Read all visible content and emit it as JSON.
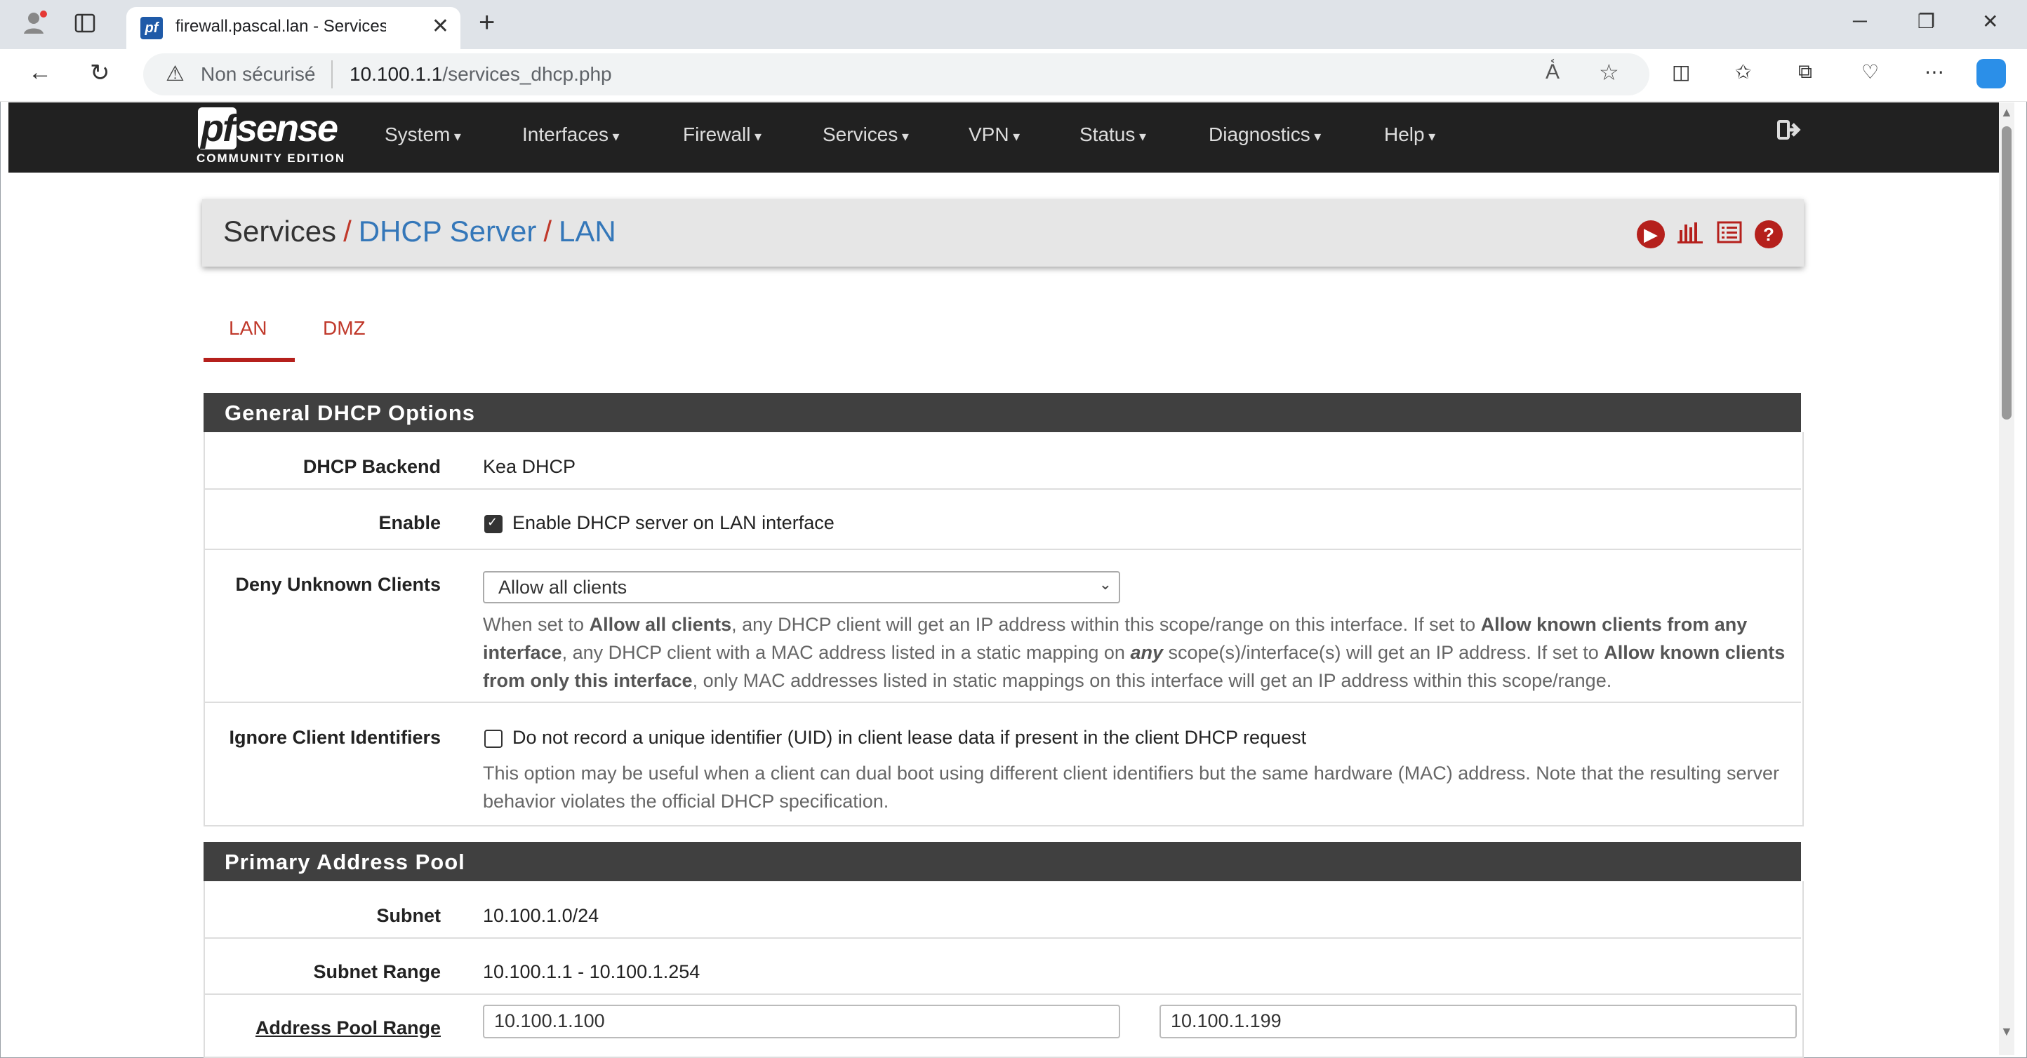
{
  "browser": {
    "tab_title": "firewall.pascal.lan - Services: DHC",
    "favicon_text": "pf",
    "new_tab": "+",
    "security_label": "Non sécurisé",
    "url_host": "10.100.1.1",
    "url_path": "/services_dhcp.php"
  },
  "nav": {
    "logo_text": "sense",
    "logo_pf": "pf",
    "logo_sub": "COMMUNITY EDITION",
    "items": [
      "System",
      "Interfaces",
      "Firewall",
      "Services",
      "VPN",
      "Status",
      "Diagnostics",
      "Help"
    ]
  },
  "breadcrumb": {
    "root": "Services",
    "mid": "DHCP Server",
    "leaf": "LAN",
    "sep": "/"
  },
  "tabs": [
    "LAN",
    "DMZ"
  ],
  "general": {
    "heading": "General DHCP Options",
    "backend_label": "DHCP Backend",
    "backend_value": "Kea DHCP",
    "enable_label": "Enable",
    "enable_text": "Enable DHCP server on LAN interface",
    "enable_checked": true,
    "deny_label": "Deny Unknown Clients",
    "deny_selected": "Allow all clients",
    "deny_help": {
      "p1": "When set to ",
      "b1": "Allow all clients",
      "p2": ", any DHCP client will get an IP address within this scope/range on this interface. If set to ",
      "b2": "Allow known clients from any interface",
      "p3": ", any DHCP client with a MAC address listed in a static mapping on ",
      "b3": "any",
      "p4": " scope(s)/interface(s) will get an IP address. If set to ",
      "b4": "Allow known clients from only this interface",
      "p5": ", only MAC addresses listed in static mappings on this interface will get an IP address within this scope/range."
    },
    "ignore_label": "Ignore Client Identifiers",
    "ignore_text": "Do not record a unique identifier (UID) in client lease data if present in the client DHCP request",
    "ignore_checked": false,
    "ignore_help": "This option may be useful when a client can dual boot using different client identifiers but the same hardware (MAC) address. Note that the resulting server behavior violates the official DHCP specification."
  },
  "pool": {
    "heading": "Primary Address Pool",
    "subnet_label": "Subnet",
    "subnet_value": "10.100.1.0/24",
    "range_label": "Subnet Range",
    "range_value": "10.100.1.1 - 10.100.1.254",
    "pool_label": "Address Pool Range",
    "pool_from": "10.100.1.100",
    "pool_to": "10.100.1.199"
  },
  "colors": {
    "nav_bg": "#212121",
    "accent_red": "#b5201c",
    "link_blue": "#3477b9",
    "panel_head": "#404040"
  }
}
